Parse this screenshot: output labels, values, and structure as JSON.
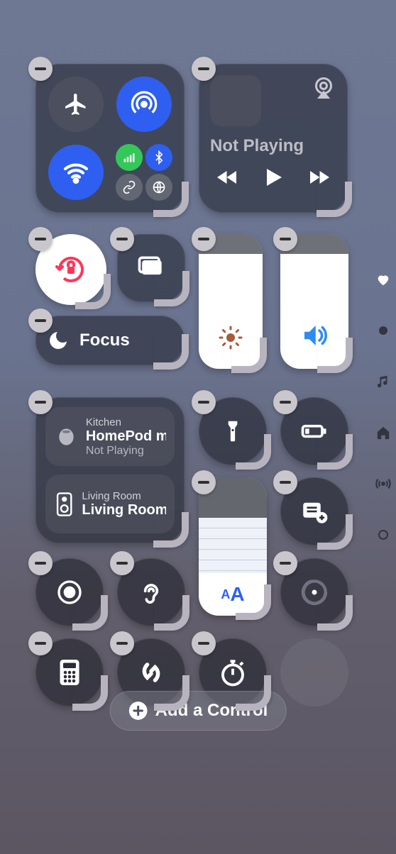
{
  "playback": {
    "title": "Not Playing"
  },
  "focus": {
    "label": "Focus"
  },
  "home": {
    "items": [
      {
        "room": "Kitchen",
        "title": "HomePod m",
        "status": "Not Playing"
      },
      {
        "room": "Living Room",
        "title": "Living Room"
      }
    ]
  },
  "controls": {
    "add_label": "Add a Control"
  }
}
